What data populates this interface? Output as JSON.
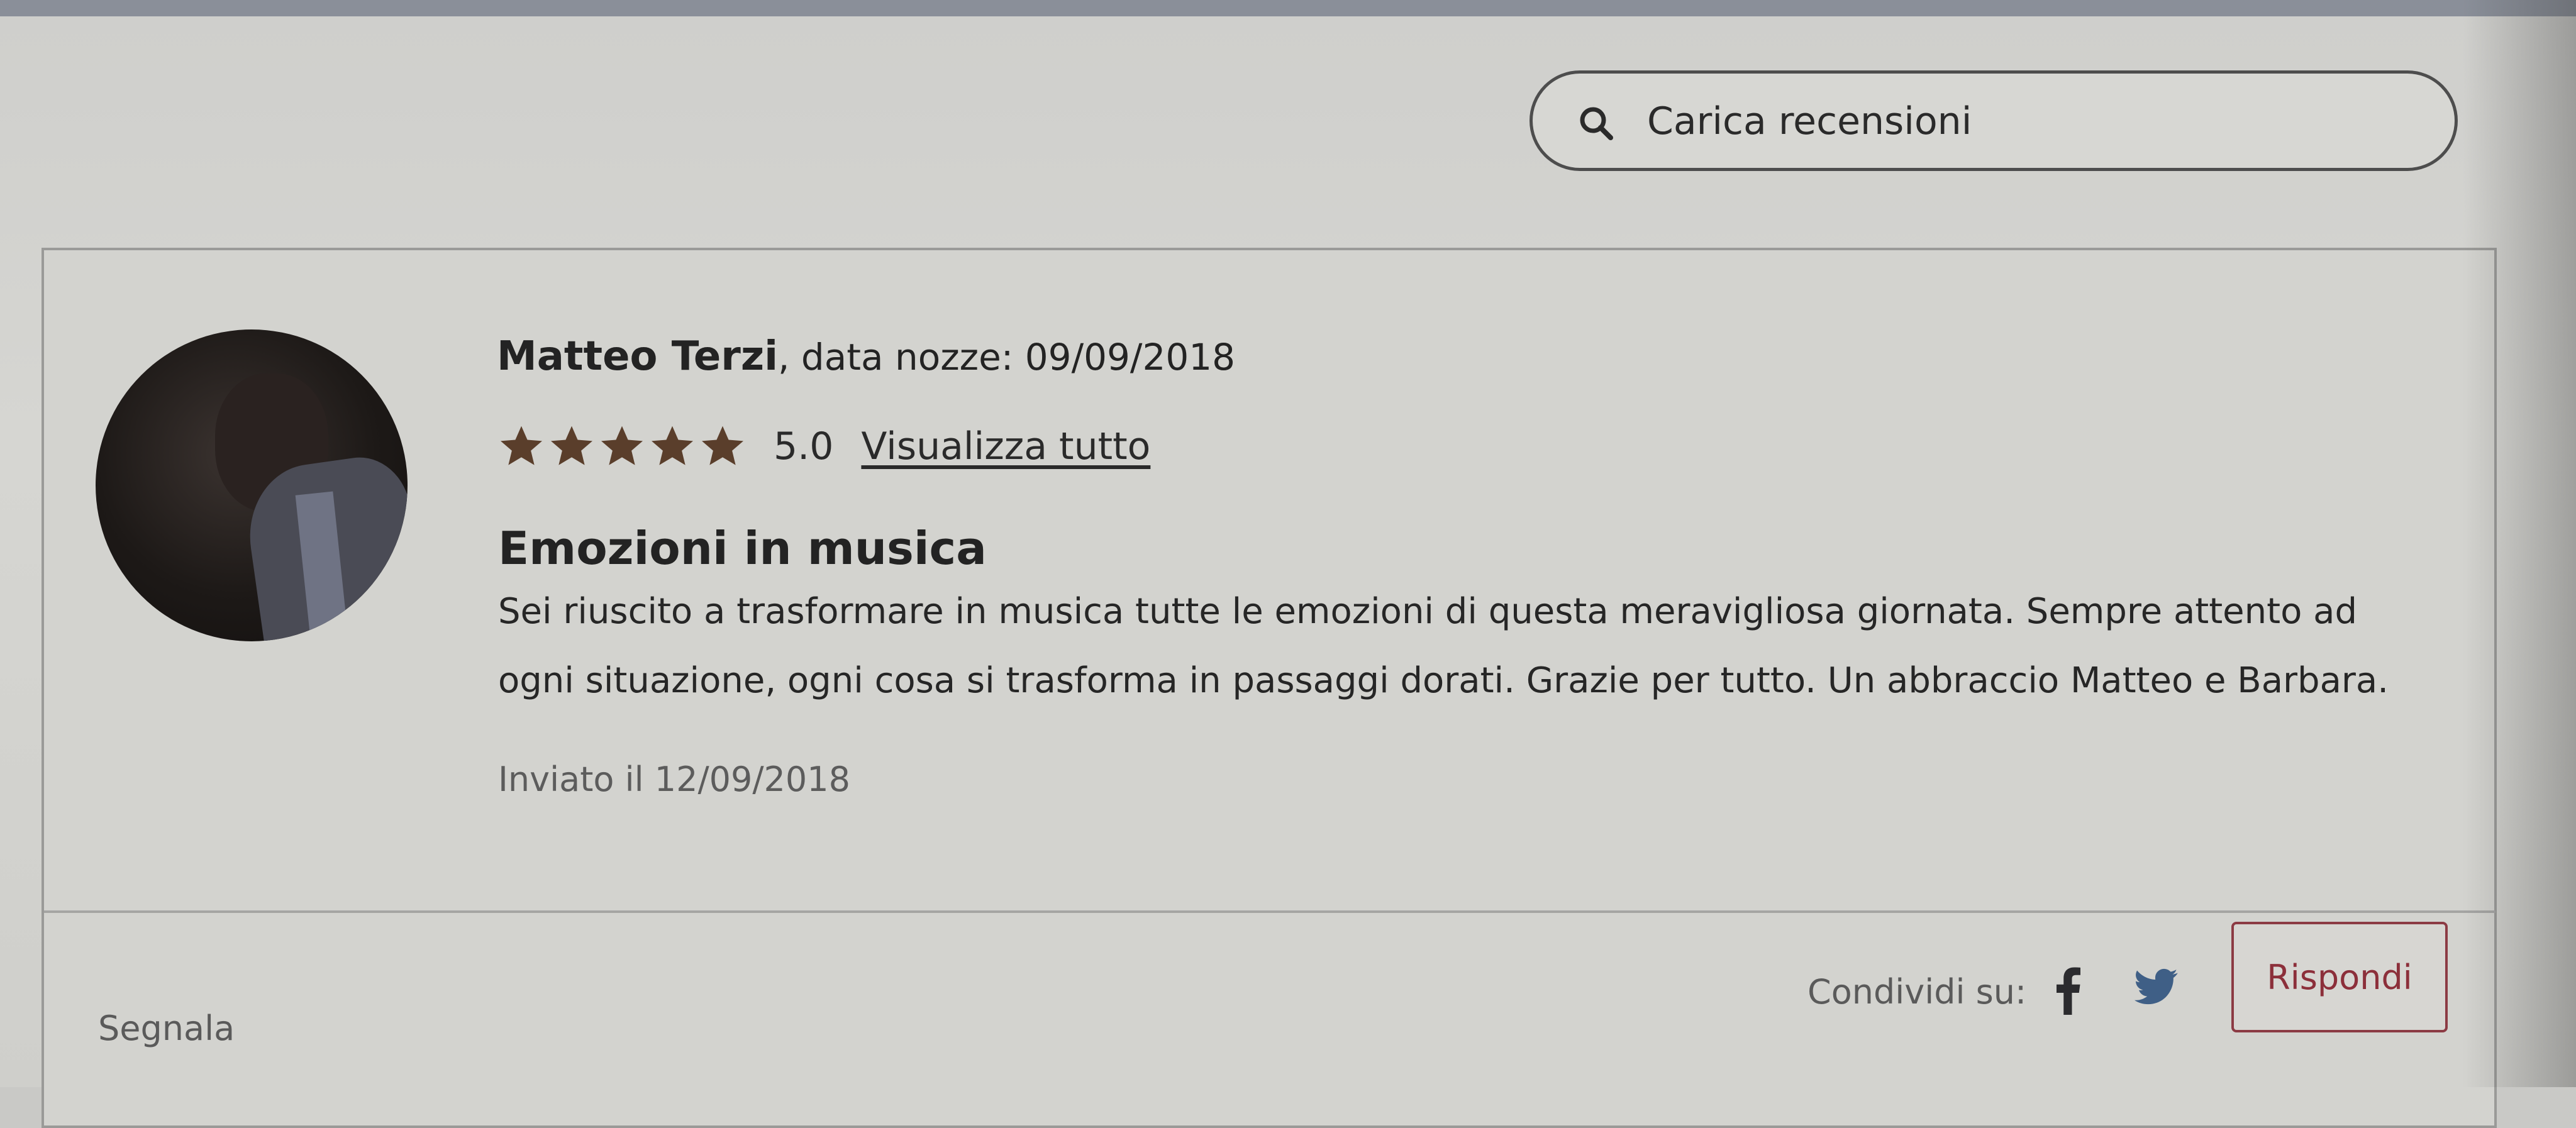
{
  "search": {
    "placeholder": "Carica recensioni",
    "icon": "search-icon"
  },
  "review": {
    "author": "Matteo Terzi",
    "meta": ", data nozze: 09/09/2018",
    "rating": 5.0,
    "rating_label": "5.0",
    "star_count": 5,
    "star_color": "#5a3e2b",
    "view_all_label": "Visualizza tutto",
    "title": "Emozioni in musica",
    "body": "Sei riuscito a trasformare in musica tutte le emozioni di questa meravigliosa giornata. Sempre attento ad ogni situazione, ogni cosa si trasforma in passaggi dorati. Grazie per tutto. Un abbraccio Matteo e Barbara.",
    "sent_date": "Inviato il 12/09/2018"
  },
  "footer": {
    "report_label": "Segnala",
    "share_label": "Condividi su:",
    "share_icons": [
      "facebook-icon",
      "twitter-icon"
    ],
    "reply_label": "Rispondi",
    "reply_color": "#8c2f3a"
  }
}
